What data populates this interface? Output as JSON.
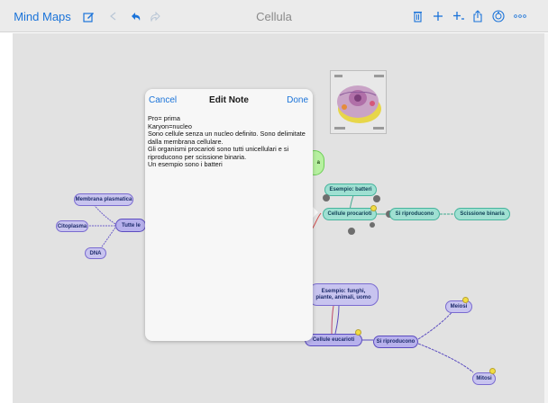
{
  "toolbar": {
    "back_label": "Mind Maps",
    "title": "Cellula",
    "icons": [
      "edit-icon",
      "prev-icon",
      "undo-icon",
      "redo-icon",
      "trash-icon",
      "add-icon",
      "add-child-icon",
      "share-icon",
      "style-icon",
      "more-icon"
    ]
  },
  "note": {
    "cancel": "Cancel",
    "title": "Edit Note",
    "done": "Done",
    "lines": [
      "Pro= prima",
      "Karyon=nucleo",
      "Sono cellule senza un nucleo definito. Sono delimitate dalla membrana cellulare.",
      "Gli organismi procarioti sono tutti unicellulari e si riproducono per scissione binaria.",
      "Un esempio sono i batteri"
    ]
  },
  "nodes": {
    "membrana": "Membrana plasmatica",
    "citoplasma": "Citoplasma",
    "tutte_le": "Tutte le",
    "dna": "DNA",
    "esempio_batteri": "Esempio: batteri",
    "cellule_procarioti": "Cellule procarioti",
    "si_riproducono_1": "Si riproducono",
    "scissione_binaria": "Scissione binaria",
    "esempio_funghi": "Esempio: funghi, piante, animali, uomo",
    "cellule_eucarioti": "Cellule eucarioti",
    "si_riproducono_2": "Si riproducono",
    "meiosi": "Meiosi",
    "mitosi": "Mitosi",
    "green_fragment": "a"
  },
  "colors": {
    "accent": "#1a73d9",
    "purple": "#c8c4ef",
    "teal": "#9fe0d2",
    "green": "#b7f0a0",
    "note_dot": "#f2dd44"
  }
}
